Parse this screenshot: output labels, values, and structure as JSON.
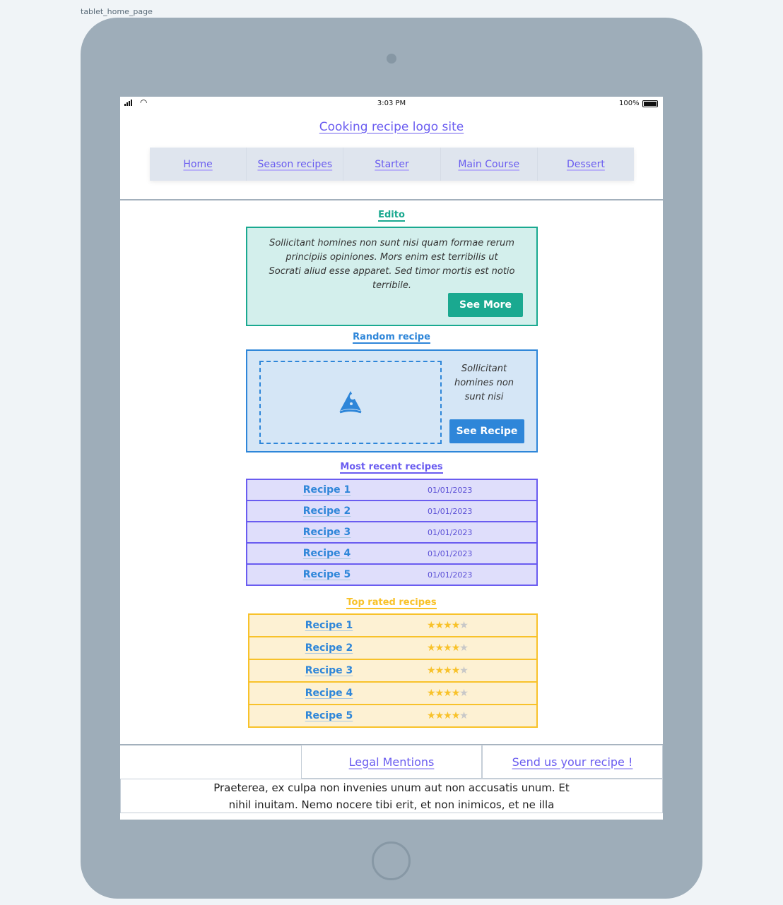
{
  "page_label": "tablet_home_page",
  "status": {
    "time": "3:03 PM",
    "battery": "100%"
  },
  "header": {
    "logo": "Cooking recipe logo site"
  },
  "nav": [
    {
      "label": "Home"
    },
    {
      "label": "Season recipes"
    },
    {
      "label": "Starter"
    },
    {
      "label": "Main Course"
    },
    {
      "label": "Dessert"
    }
  ],
  "edito": {
    "title": "Edito",
    "text": "Sollicitant homines non sunt nisi quam formae rerum principiis opiniones. Mors enim est terribilis ut Socrati aliud esse apparet. Sed timor mortis est notio terribile.",
    "button": "See More",
    "color": "#1aa990"
  },
  "random": {
    "title": "Random recipe",
    "text": "Sollicitant homines non sunt nisi",
    "button": "See Recipe",
    "icon": "pizza-icon",
    "color": "#2e86d9"
  },
  "recent": {
    "title": "Most recent recipes",
    "color": "#6a5cf0",
    "items": [
      {
        "name": "Recipe 1",
        "date": "01/01/2023"
      },
      {
        "name": "Recipe 2",
        "date": "01/01/2023"
      },
      {
        "name": "Recipe 3",
        "date": "01/01/2023"
      },
      {
        "name": "Recipe 4",
        "date": "01/01/2023"
      },
      {
        "name": "Recipe 5",
        "date": "01/01/2023"
      }
    ]
  },
  "top": {
    "title": "Top rated recipes",
    "color": "#f8c22a",
    "max_rating": 5,
    "items": [
      {
        "name": "Recipe 1",
        "rating": 4
      },
      {
        "name": "Recipe 2",
        "rating": 4
      },
      {
        "name": "Recipe 3",
        "rating": 4
      },
      {
        "name": "Recipe 4",
        "rating": 4
      },
      {
        "name": "Recipe 5",
        "rating": 4
      }
    ]
  },
  "footer": {
    "legal": "Legal Mentions",
    "send": "Send us your recipe !",
    "text": "Praeterea, ex culpa non invenies unum aut non accusatis unum. Et nihil inuitam. Nemo nocere tibi erit, et non inimicos, et ne illa"
  }
}
